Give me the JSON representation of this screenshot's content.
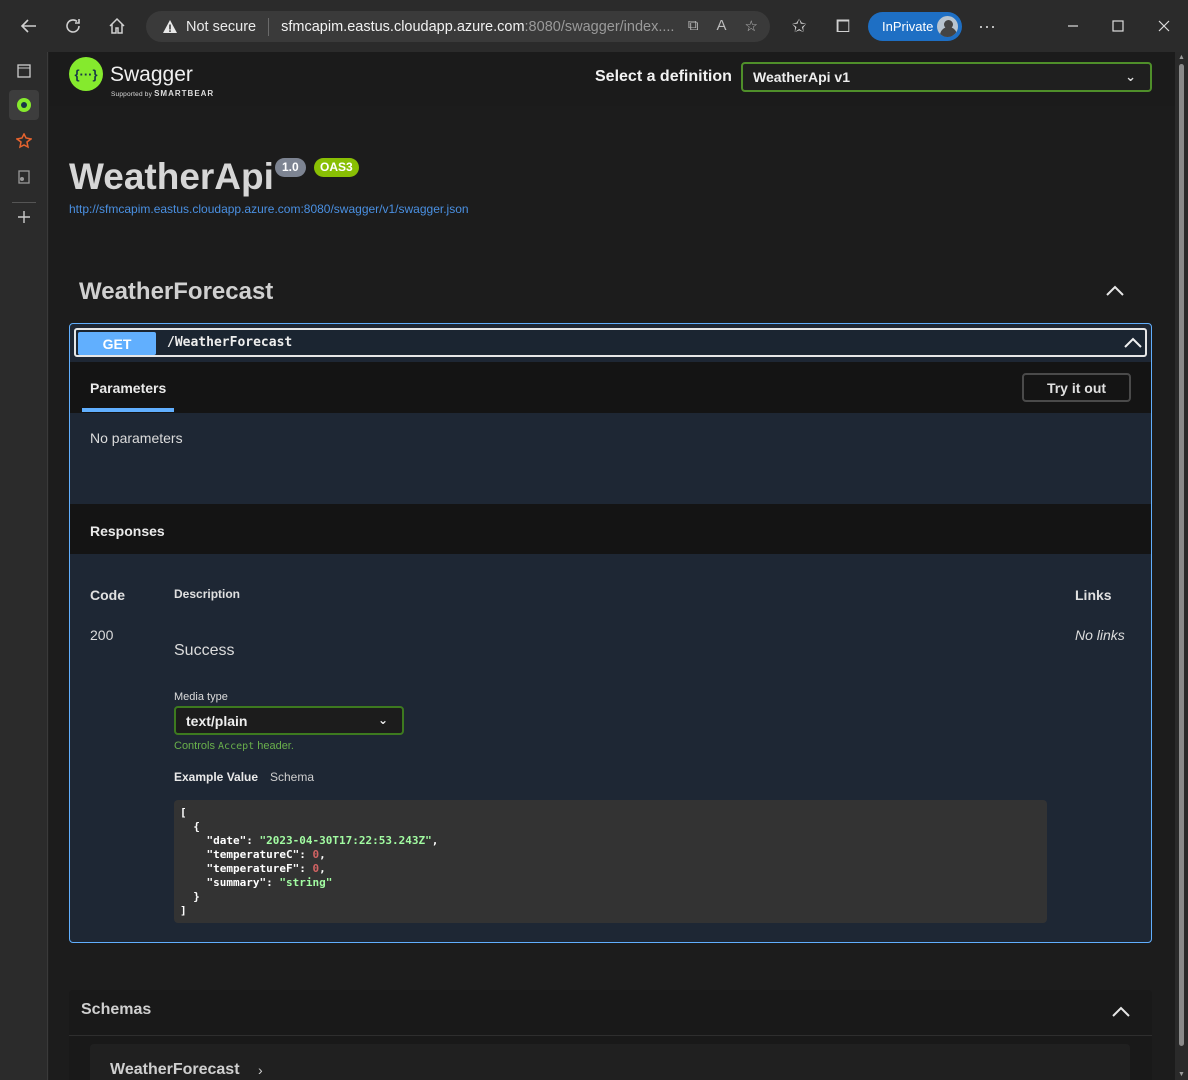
{
  "browser": {
    "address": {
      "security_label": "Not secure",
      "host": "sfmcapim.eastus.cloudapp.azure.com",
      "path": ":8080/swagger/index...."
    },
    "inprivate_label": "InPrivate"
  },
  "swagger": {
    "logo_text": "Swagger",
    "logo_sub_prefix": "Supported by",
    "logo_sub_brand": "SMARTBEAR",
    "select_definition_label": "Select a definition",
    "definition_selected": "WeatherApi v1",
    "info": {
      "title": "WeatherApi",
      "version": "1.0",
      "oas": "OAS3",
      "url": "http://sfmcapim.eastus.cloudapp.azure.com:8080/swagger/v1/swagger.json"
    },
    "tag": {
      "name": "WeatherForecast"
    },
    "operation": {
      "method": "GET",
      "path": "/WeatherForecast",
      "parameters_tab": "Parameters",
      "try_it_out": "Try it out",
      "no_parameters": "No parameters",
      "responses_title": "Responses",
      "columns": {
        "code": "Code",
        "description": "Description",
        "links": "Links"
      },
      "response": {
        "code": "200",
        "description": "Success",
        "links": "No links",
        "media_type_label": "Media type",
        "media_type": "text/plain",
        "controls_prefix": "Controls",
        "controls_code": "Accept",
        "controls_suffix": "header.",
        "example_tab": "Example Value",
        "schema_tab": "Schema",
        "example": {
          "date": "\"2023-04-30T17:22:53.243Z\"",
          "temperatureC": "0",
          "temperatureF": "0",
          "summary": "\"string\""
        }
      }
    },
    "schemas": {
      "title": "Schemas",
      "models": [
        "WeatherForecast"
      ]
    }
  },
  "colors": {
    "get_method": "#61affe",
    "swagger_green": "#85ea2d",
    "oas_badge": "#89bf04",
    "inprivate": "#1e6fc4"
  }
}
